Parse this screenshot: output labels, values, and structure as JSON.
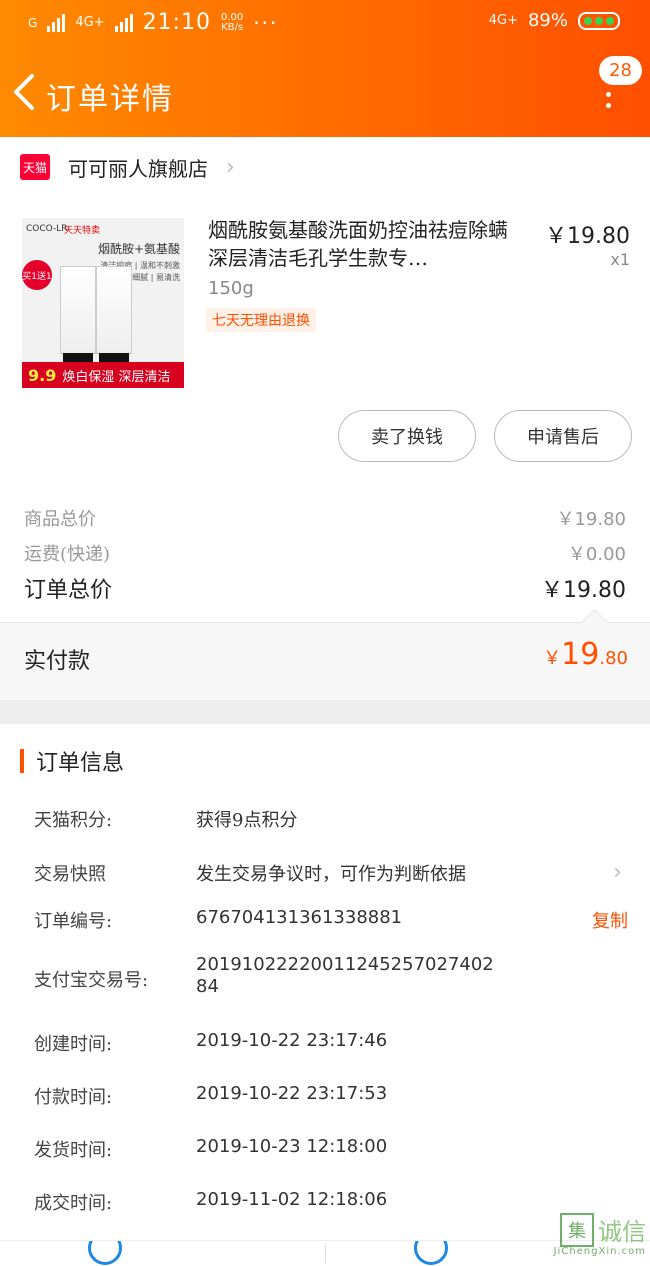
{
  "status_bar": {
    "sim1": "G",
    "sim2": "4G+",
    "time": "21:10",
    "speed_value": "0.00",
    "speed_unit": "KB/s",
    "dots": "···",
    "net": "4G+",
    "battery": "89%"
  },
  "nav": {
    "title": "订单详情",
    "badge_count": "28"
  },
  "store": {
    "platform_icon_text": "天猫",
    "name": "可可丽人旗舰店"
  },
  "product": {
    "image_brand": "COCO-LR",
    "image_tag": "天天特卖",
    "image_header": "烟酰胺+氨基酸",
    "image_sub1": "清洁控痘 | 温和不刺激",
    "image_sub2": "泡沫细腻 | 易清洗",
    "image_promo": "买1送1",
    "image_strip_price": "9.9",
    "image_strip_text": "焕白保湿 深层清洁",
    "name": "烟酰胺氨基酸洗面奶控油祛痘除螨深层清洁毛孔学生款专…",
    "price": "￥19.80",
    "qty": "x1",
    "spec": "150g",
    "return_policy": "七天无理由退换"
  },
  "actions": {
    "sell_label": "卖了换钱",
    "after_sale_label": "申请售后"
  },
  "summary": {
    "goods_total_label": "商品总价",
    "goods_total_value": "￥19.80",
    "shipping_label": "运费(快递)",
    "shipping_value": "￥0.00",
    "order_total_label": "订单总价",
    "order_total_value": "￥19.80",
    "paid_label": "实付款",
    "paid_currency": "￥",
    "paid_int": "19",
    "paid_dec": ".80"
  },
  "order_info": {
    "title": "订单信息",
    "points_label": "天猫积分:",
    "points_value": "获得9点积分",
    "snapshot_label": "交易快照",
    "snapshot_value": "发生交易争议时，可作为判断依据",
    "order_no_label": "订单编号:",
    "order_no_value": "676704131361338881",
    "copy_label": "复制",
    "alipay_label": "支付宝交易号:",
    "alipay_value_line1": "20191022220011245257027402",
    "alipay_value_line2": "84",
    "created_label": "创建时间:",
    "created_value": "2019-10-22 23:17:46",
    "paid_time_label": "付款时间:",
    "paid_time_value": "2019-10-22 23:17:53",
    "shipped_label": "发货时间:",
    "shipped_value": "2019-10-23 12:18:00",
    "completed_label": "成交时间:",
    "completed_value": "2019-11-02 12:18:06"
  },
  "watermark": {
    "box": "集",
    "text": "诚信",
    "url": "JiChengXin.com"
  },
  "colors": {
    "header_start": "#ff8a00",
    "header_end": "#ff4f00",
    "accent": "#ff5000",
    "tmall_red": "#ff0036"
  }
}
